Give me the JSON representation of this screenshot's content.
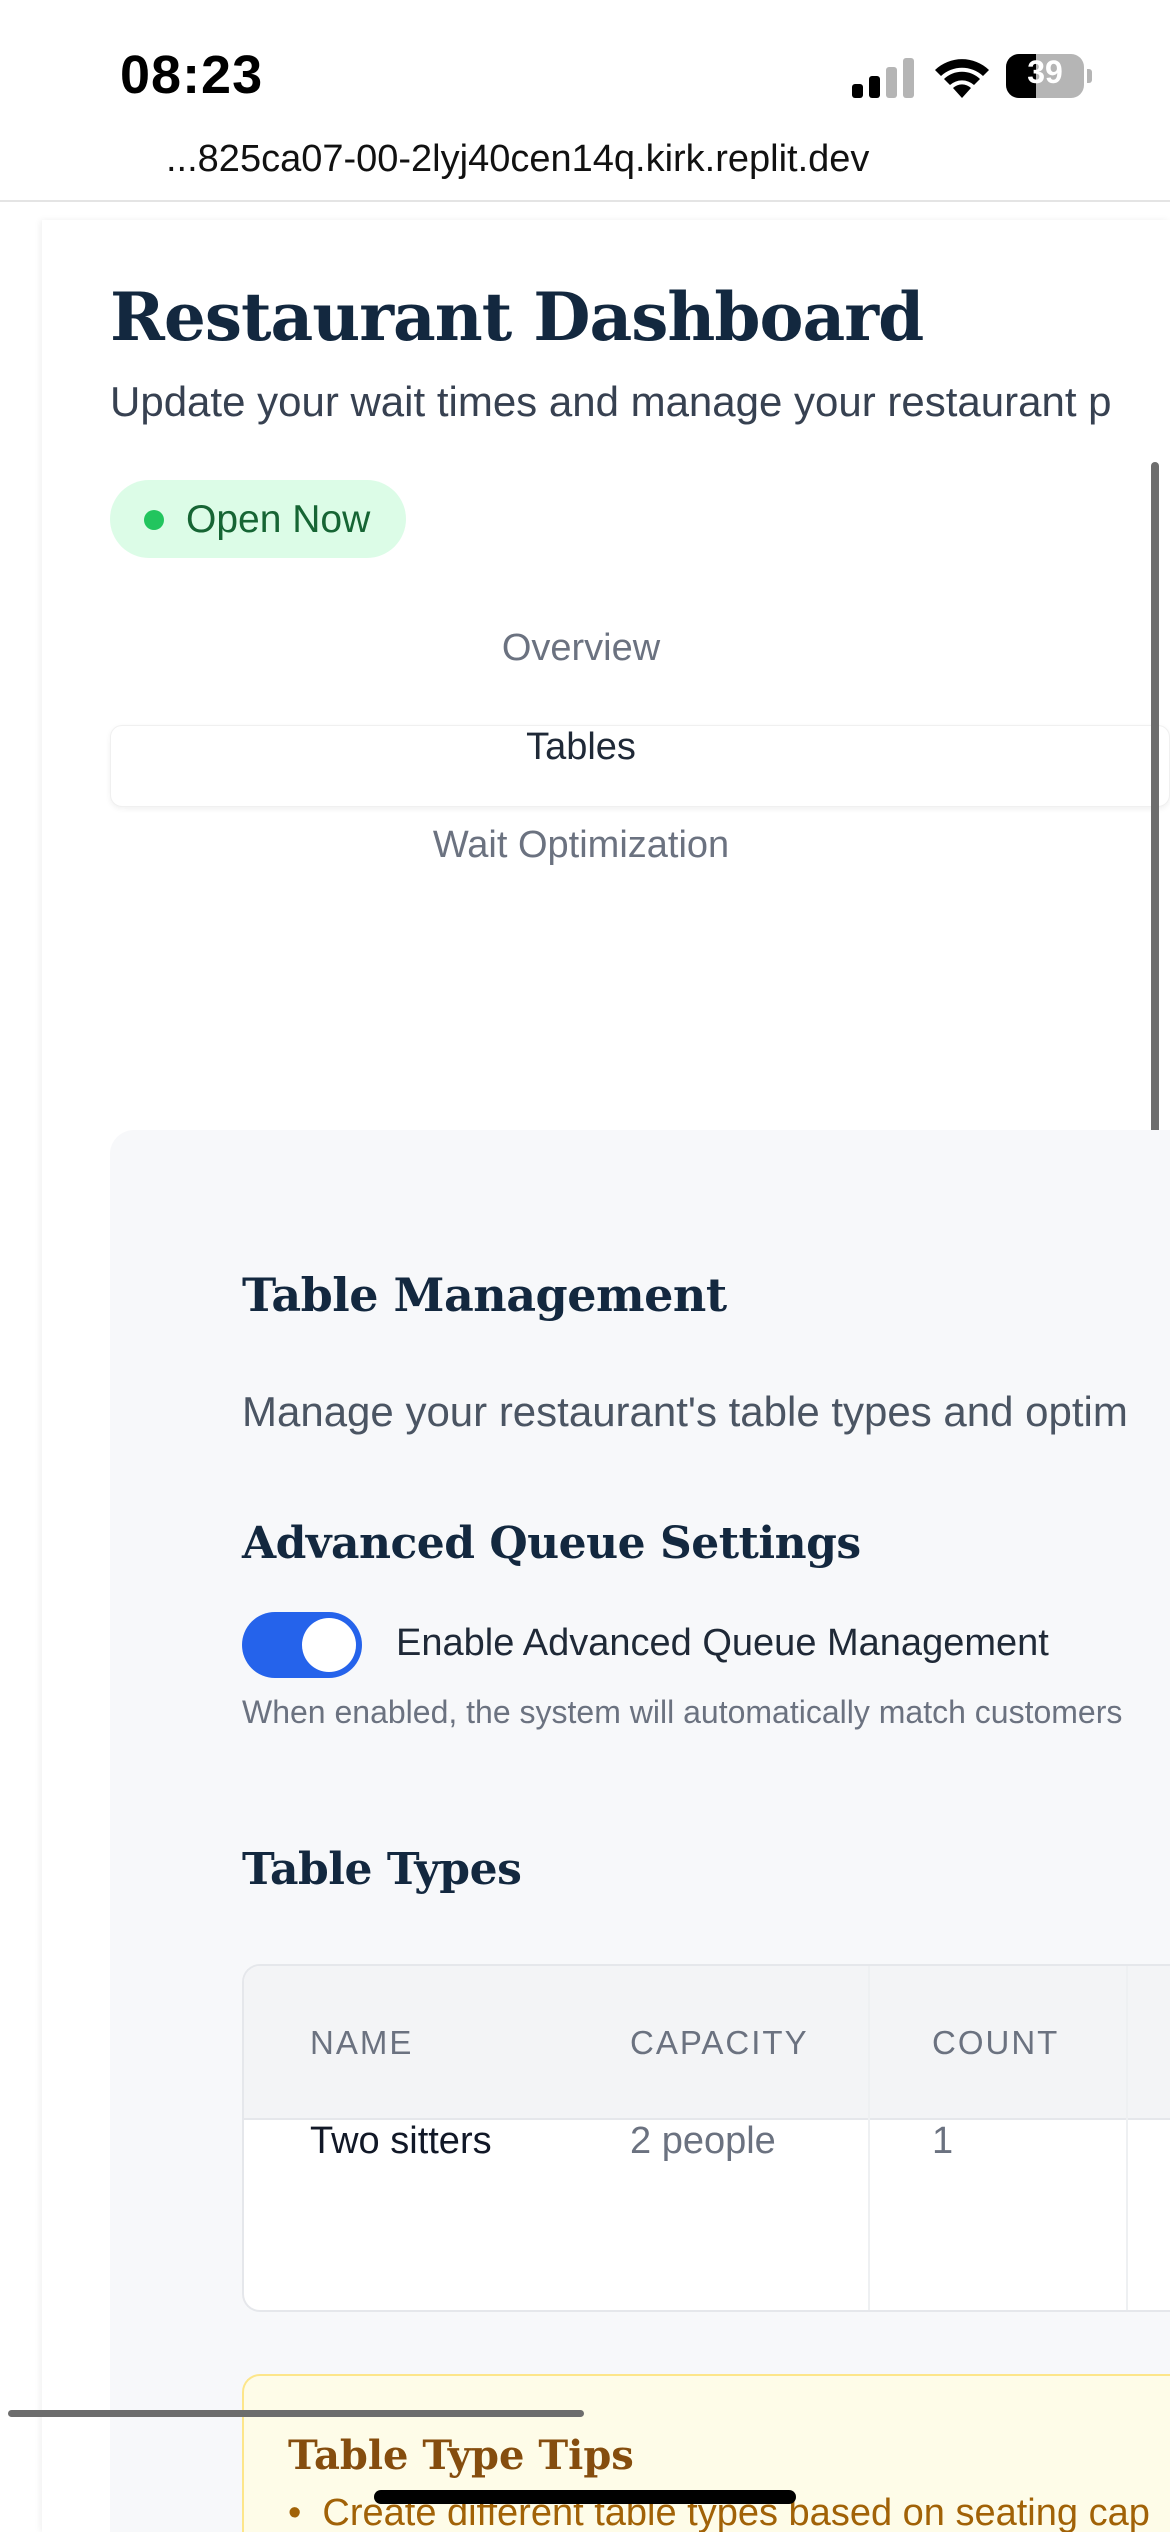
{
  "status_bar": {
    "time": "08:23",
    "battery_level": "39",
    "battery_fraction": 0.39,
    "signal_icon": "cellular-signal-icon",
    "wifi_icon": "wifi-icon",
    "battery_icon": "battery-icon"
  },
  "browser": {
    "url": "...825ca07-00-2lyj40cen14q.kirk.replit.dev"
  },
  "header": {
    "title": "Restaurant Dashboard",
    "subtitle": "Update your wait times and manage your restaurant p",
    "status_badge": "Open Now"
  },
  "tabs": [
    {
      "label": "Overview",
      "active": false
    },
    {
      "label": "Tables",
      "active": true
    },
    {
      "label": "Wait Optimization",
      "active": false
    }
  ],
  "table_management": {
    "title": "Table Management",
    "description": "Manage your restaurant's table types and optim",
    "advanced_queue": {
      "title": "Advanced Queue Settings",
      "toggle_label": "Enable Advanced Queue Management",
      "toggle_on": true,
      "help_text": "When enabled, the system will automatically match customers"
    },
    "table_types": {
      "title": "Table Types",
      "columns": [
        "NAME",
        "CAPACITY",
        "COUNT"
      ],
      "rows": [
        [
          "Two sitters",
          "2 people",
          "1"
        ]
      ]
    },
    "tips": {
      "title": "Table Type Tips",
      "bullet": "Create different table types based on seating cap"
    }
  },
  "colors": {
    "title": "#13283f",
    "badge_bg": "#dcfce7",
    "badge_dot": "#22c55e",
    "toggle_on": "#2563eb",
    "tips_bg": "#fefce8",
    "tips_title": "#854d0e"
  }
}
